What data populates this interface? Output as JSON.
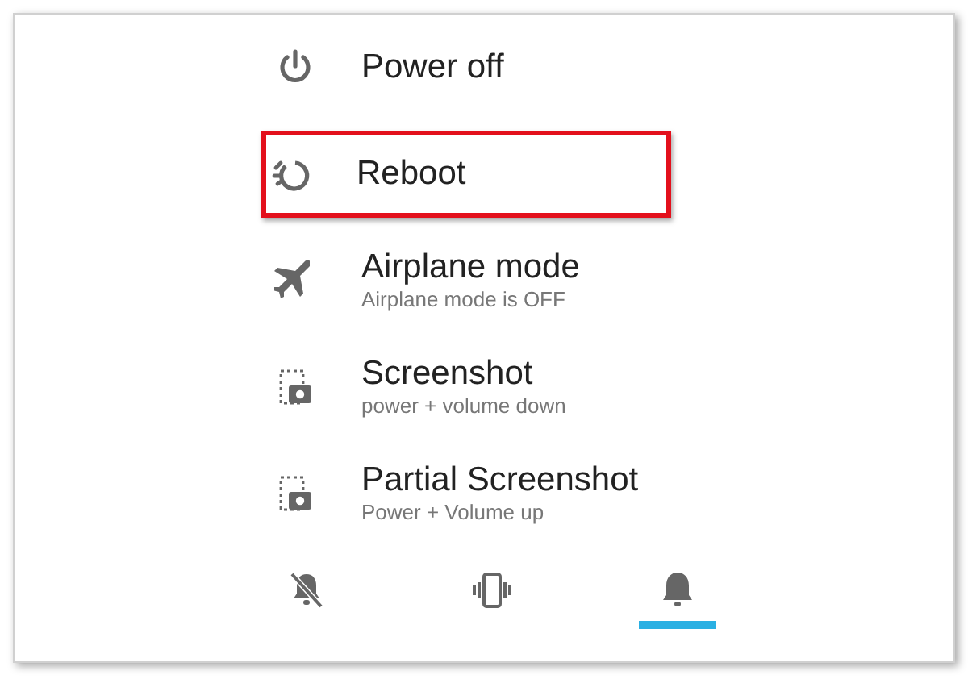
{
  "power_menu": {
    "items": [
      {
        "label": "Power off",
        "highlighted": false
      },
      {
        "label": "Reboot",
        "highlighted": true
      },
      {
        "label": "Airplane mode",
        "subtitle": "Airplane mode is OFF",
        "highlighted": false
      },
      {
        "label": "Screenshot",
        "subtitle": "power + volume down",
        "highlighted": false
      },
      {
        "label": "Partial Screenshot",
        "subtitle": "Power + Volume up",
        "highlighted": false
      }
    ]
  },
  "sound_modes": [
    {
      "selected": false
    },
    {
      "selected": false
    },
    {
      "selected": true
    }
  ]
}
